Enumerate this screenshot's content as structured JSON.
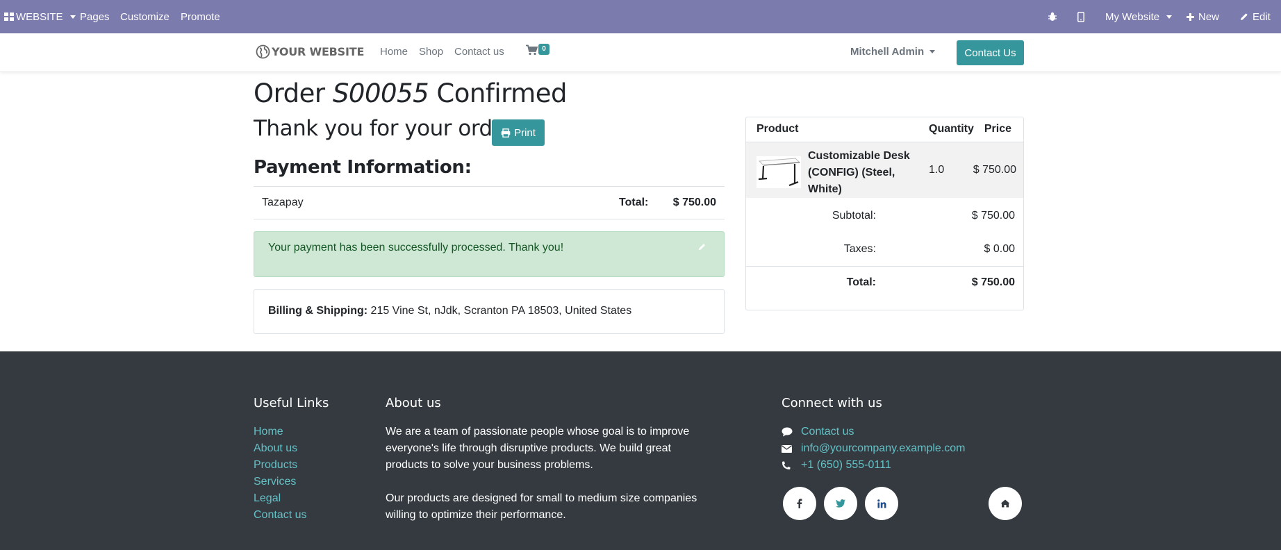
{
  "admin_bar": {
    "website_menu": "WEBSITE",
    "pages": "Pages",
    "customize": "Customize",
    "promote": "Promote",
    "site_selector": "My Website",
    "new": "New",
    "edit": "Edit"
  },
  "header": {
    "logo_text": "YOUR WEBSITE",
    "nav": [
      "Home",
      "Shop",
      "Contact us"
    ],
    "cart_count": "0",
    "user": "Mitchell Admin",
    "contact_button": "Contact Us"
  },
  "order": {
    "title_prefix": "Order ",
    "reference": "S00055",
    "title_suffix": " Confirmed",
    "thanks": "Thank you for your order.",
    "print_label": "Print",
    "payment_heading": "Payment Information:",
    "acquirer": "Tazapay",
    "total_label": "Total:",
    "total_value": "$ 750.00",
    "success_message": "Your payment has been successfully processed. Thank you!",
    "billing_label": "Billing & Shipping:",
    "billing_address": " 215 Vine St, nJdk, Scranton PA 18503, United States"
  },
  "summary": {
    "headers": {
      "product": "Product",
      "quantity": "Quantity",
      "price": "Price"
    },
    "product_name": "Customizable Desk (CONFIG) (Steel, White)",
    "product_qty": "1.0",
    "product_price": "$ 750.00",
    "subtotal_label": "Subtotal:",
    "subtotal_value": "$ 750.00",
    "taxes_label": "Taxes:",
    "taxes_value": "$ 0.00",
    "total_label": "Total:",
    "total_value": "$ 750.00"
  },
  "footer": {
    "useful_links_heading": "Useful Links",
    "links": [
      "Home",
      "About us",
      "Products",
      "Services",
      "Legal",
      "Contact us"
    ],
    "about_heading": "About us",
    "about_p1": "We are a team of passionate people whose goal is to improve everyone's life through disruptive products. We build great products to solve your business problems.",
    "about_p2": "Our products are designed for small to medium size companies willing to optimize their performance.",
    "connect_heading": "Connect with us",
    "contact_link": "Contact us",
    "email": "info@yourcompany.example.com",
    "phone": "+1 (650) 555-0111"
  },
  "colors": {
    "admin_bar": "#7c7bad",
    "primary": "#35979c",
    "footer_bg": "#343a40",
    "footer_link": "#63c1c6",
    "alert_bg": "#cfe8d6"
  },
  "icons": [
    "apps-icon",
    "bug-icon",
    "mobile-icon",
    "plus-icon",
    "pencil-icon",
    "globe-icon",
    "cart-icon",
    "print-icon",
    "comment-icon",
    "envelope-icon",
    "phone-icon",
    "facebook-icon",
    "twitter-icon",
    "linkedin-icon",
    "home-icon"
  ]
}
